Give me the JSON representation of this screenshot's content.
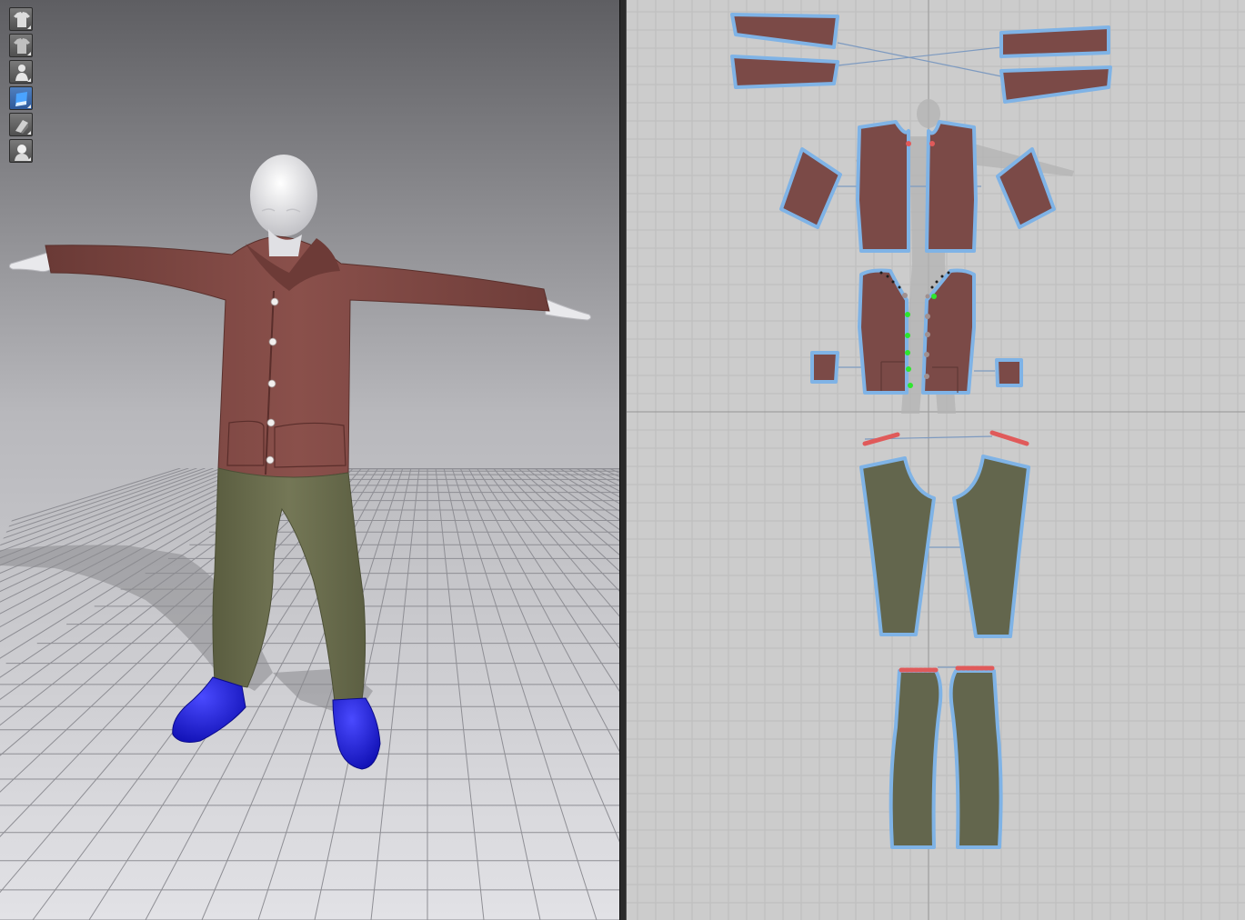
{
  "viewport_3d": {
    "toolbar": [
      {
        "name": "show-garment-icon",
        "active": false
      },
      {
        "name": "garment-display-icon",
        "active": false
      },
      {
        "name": "show-avatar-icon",
        "active": false
      },
      {
        "name": "fabric-render-icon",
        "active": true
      },
      {
        "name": "texture-display-icon",
        "active": false
      },
      {
        "name": "avatar-display-icon",
        "active": false
      }
    ],
    "colors": {
      "background_top": "#5e5e62",
      "background_bottom": "#e2e2e6",
      "shirt": "#7b4540",
      "pants": "#6b6e4e",
      "shoes": "#1a1ad6",
      "skin": "#ececee"
    }
  },
  "viewport_2d": {
    "colors": {
      "background": "#cccccc",
      "grid": "#bdbdbd",
      "shirt_fabric": "#7b4a47",
      "pants_fabric": "#63664d",
      "outline": "#7fb3e6",
      "elastic": "#e05a5a",
      "button_marker": "#2ee62e"
    }
  }
}
